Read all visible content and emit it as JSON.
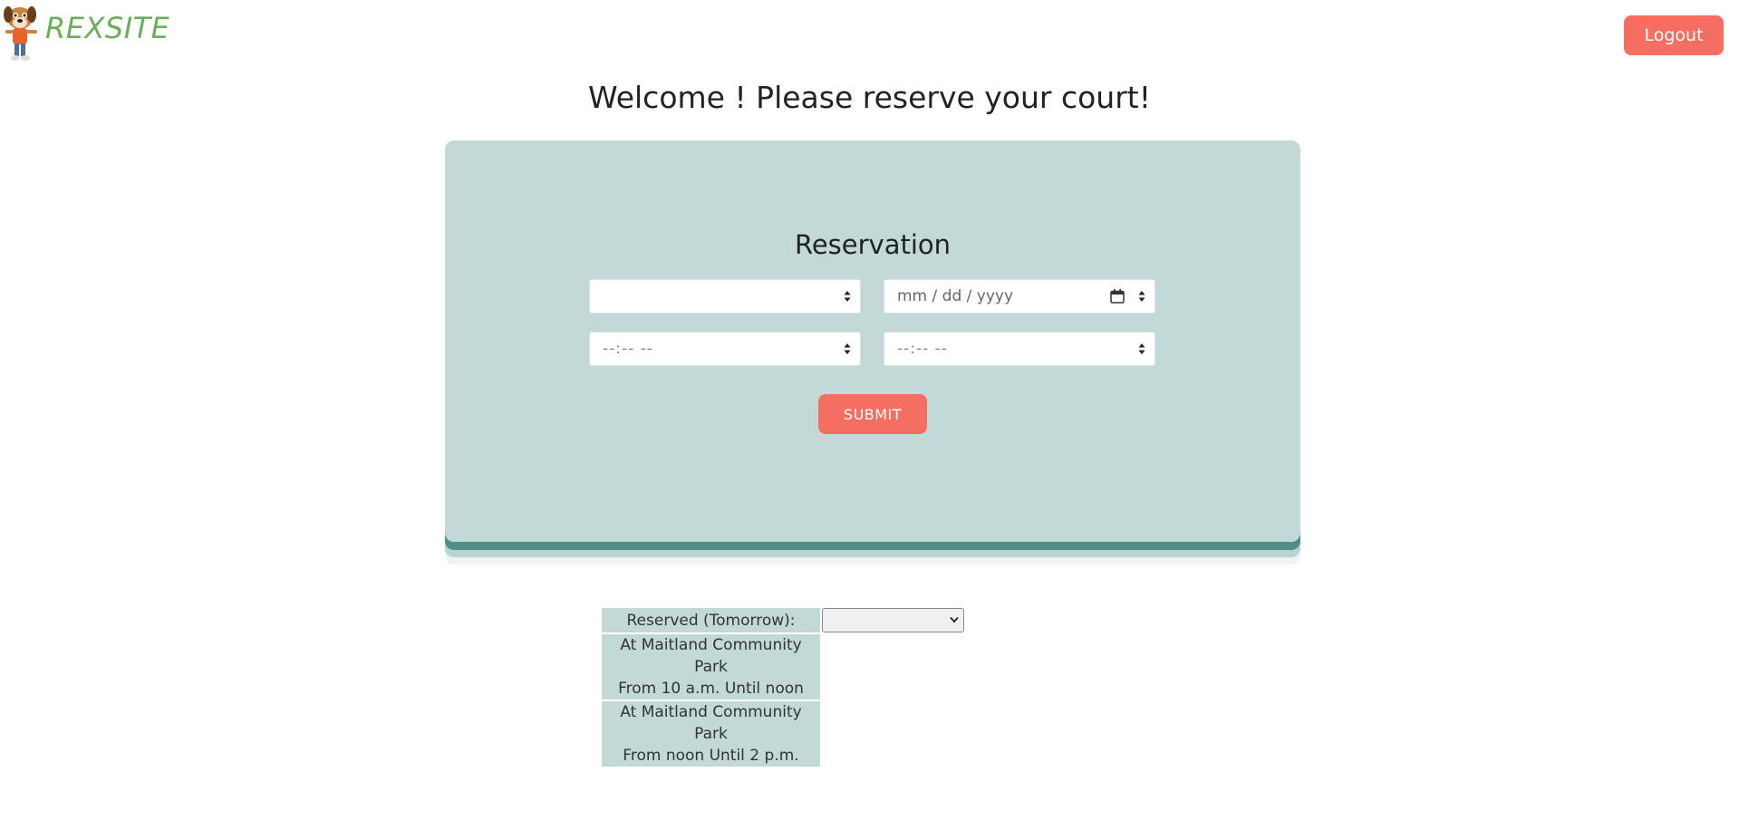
{
  "header": {
    "brand": "REXSITE",
    "logout_label": "Logout"
  },
  "welcome": "Welcome ! Please reserve your court!",
  "reservation": {
    "title": "Reservation",
    "court_select_value": "",
    "date_placeholder": "mm / dd / yyyy",
    "start_time_placeholder": "--:--  --",
    "end_time_placeholder": "--:--  --",
    "submit_label": "SUBMIT"
  },
  "reserved_table": {
    "header": "Reserved (Tomorrow):",
    "filter_value": "",
    "rows": [
      {
        "line1": "At Maitland Community Park",
        "line2": "From 10 a.m. Until noon"
      },
      {
        "line1": "At Maitland Community Park",
        "line2": "From noon Until 2 p.m."
      }
    ]
  },
  "colors": {
    "brand_green": "#6aad5a",
    "accent_coral": "#f46e61",
    "card_bg": "#c2d9d8",
    "card_edge": "#4f8f88"
  },
  "icons": [
    "mascot-logo-icon",
    "calendar-icon",
    "spinner-arrows-icon",
    "chevron-down-icon"
  ]
}
